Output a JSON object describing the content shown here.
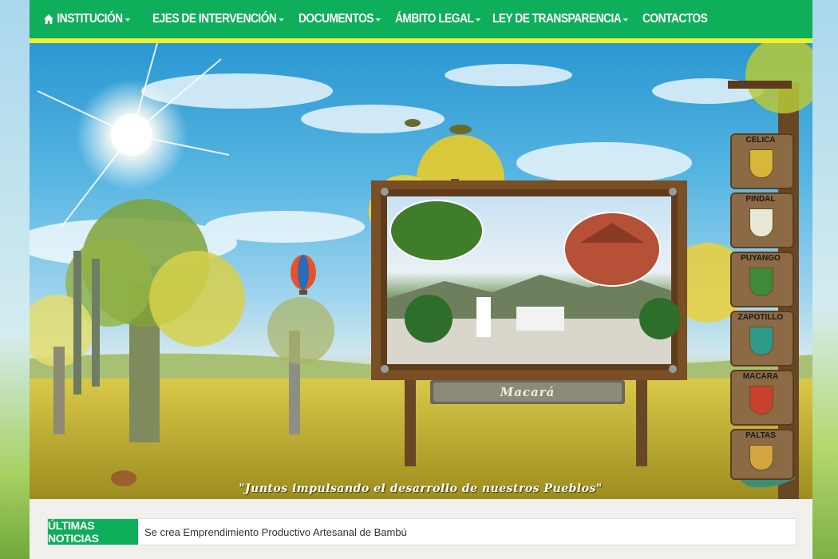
{
  "nav": {
    "items": [
      {
        "label": "INSTITUCIÓN",
        "has_dropdown": true,
        "icon": "home-icon"
      },
      {
        "label": "EJES DE INTERVENCIÓN",
        "has_dropdown": true
      },
      {
        "label": "DOCUMENTOS",
        "has_dropdown": true
      },
      {
        "label": "ÁMBITO LEGAL",
        "has_dropdown": true
      },
      {
        "label": "LEY DE TRANSPARENCIA",
        "has_dropdown": true
      },
      {
        "label": "CONTACTOS",
        "has_dropdown": false
      }
    ]
  },
  "banner": {
    "signboard_label": "Macará",
    "slogan": "\"Juntos impulsando el desarrollo de nuestros Pueblos\"",
    "cantons": [
      "CELICA",
      "PINDAL",
      "PUYANGO",
      "ZAPOTILLO",
      "MACARA",
      "PALTAS"
    ]
  },
  "news": {
    "label": "ÚLTIMAS NOTICIAS",
    "headline": "Se crea Emprendimiento Productivo Artesanal de Bambú"
  },
  "colors": {
    "nav_green": "#0fae5a",
    "nav_yellow": "#f4ef27",
    "wood": "#7a4f25"
  }
}
